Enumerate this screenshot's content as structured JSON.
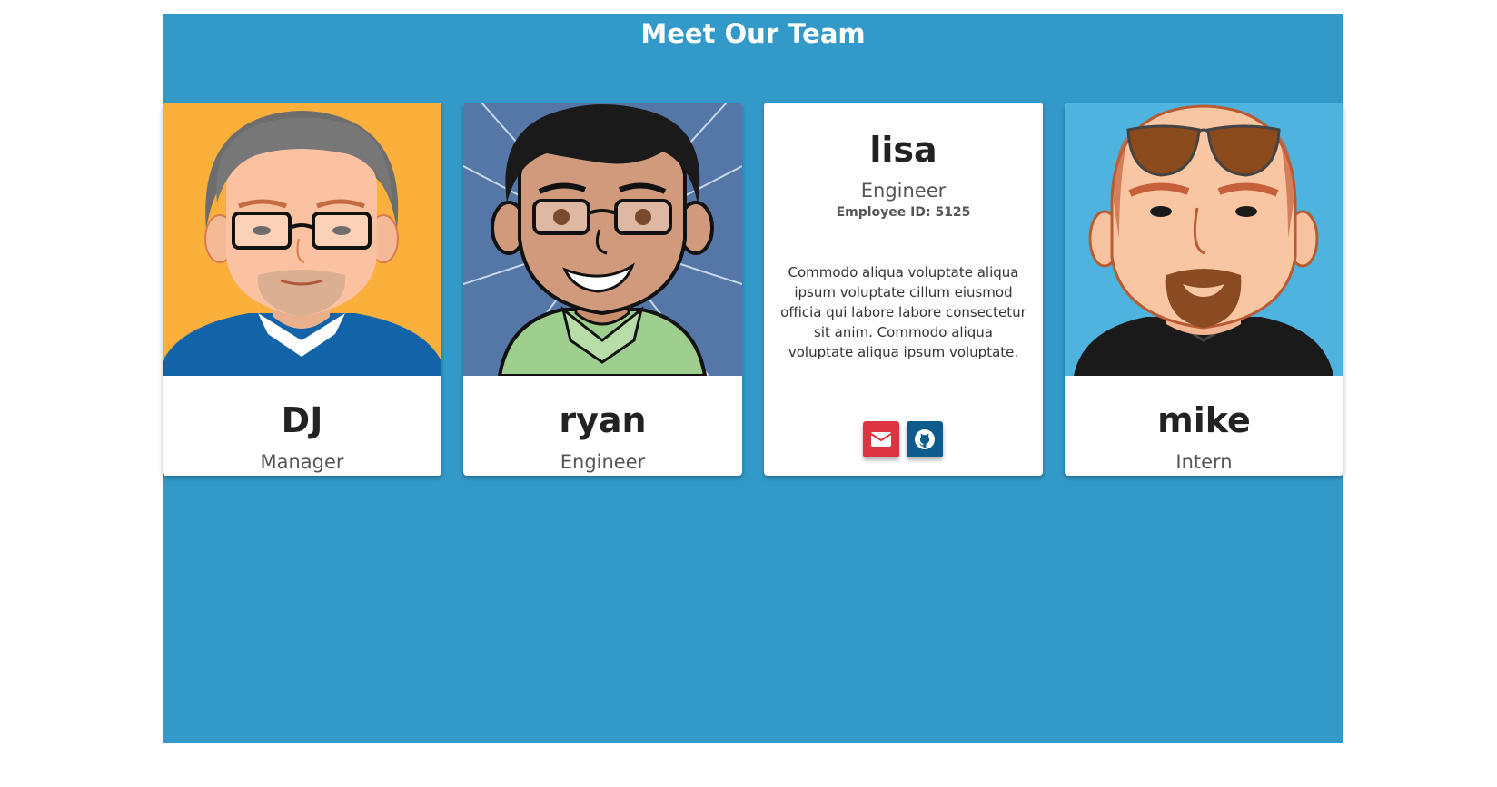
{
  "page": {
    "title": "Meet Our Team",
    "section_color": "#3399c9"
  },
  "team": [
    {
      "name": "DJ",
      "role": "Manager",
      "avatar": "cartoon-man-glasses-gray-hair",
      "bg": "#fbb03b"
    },
    {
      "name": "ryan",
      "role": "Engineer",
      "avatar": "cartoon-man-glasses-black-hair",
      "bg": "#5577a8"
    },
    {
      "name": "lisa",
      "role": "Engineer",
      "employee_id_label": "Employee ID:",
      "employee_id": "5125",
      "bio": "Commodo aliqua voluptate aliqua ipsum voluptate cillum eiusmod officia qui labore labore consectetur sit anim. Commodo aliqua voluptate aliqua ipsum voluptate.",
      "buttons": [
        {
          "icon": "envelope-icon",
          "color": "#dc3440"
        },
        {
          "icon": "github-icon",
          "color": "#0e5c8c"
        }
      ]
    },
    {
      "name": "mike",
      "role": "Intern",
      "avatar": "cartoon-man-sunglasses-goatee",
      "bg": "#4fb3e0"
    }
  ]
}
